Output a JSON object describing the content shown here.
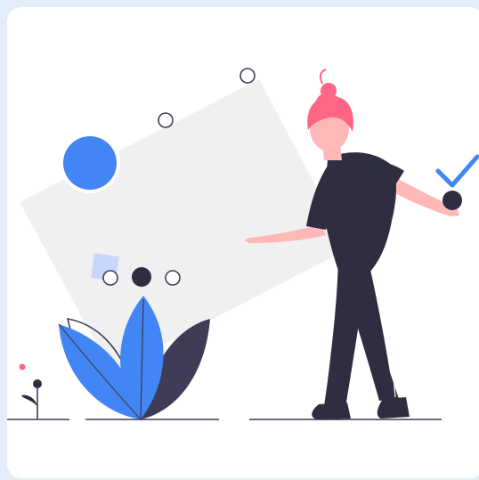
{
  "illustration": {
    "subject": "woman-arranging-shapes",
    "icons": [
      "checkmark-icon",
      "circle-icon",
      "leaf-plant-icon",
      "flower-icon"
    ],
    "colors": {
      "background": "#e3edf9",
      "card": "#ffffff",
      "accent_blue": "#4285f4",
      "dark_navy": "#2f2e41",
      "hair_pink": "#ff6584",
      "skin": "#ffb8b8",
      "panel_gray": "#f0f0f0",
      "light_blue_square": "#c5d8fb",
      "ground_line": "#3f3d56"
    }
  }
}
